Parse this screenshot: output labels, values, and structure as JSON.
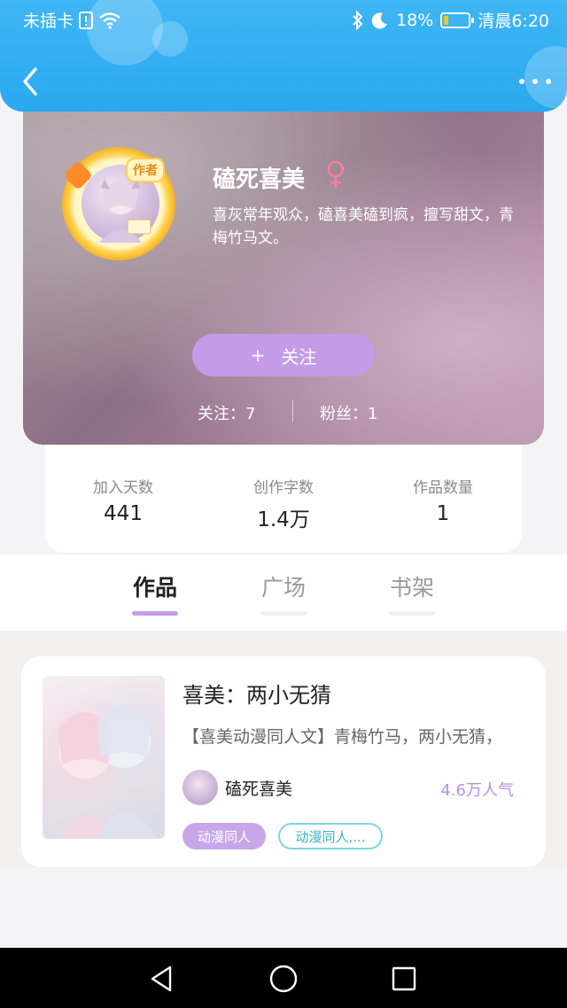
{
  "status_bar": {
    "carrier": "未插卡",
    "battery_percent": "18%",
    "battery_level": 0.18,
    "time": "清晨6:20",
    "icons": [
      "sim-alert-icon",
      "wifi-icon",
      "bluetooth-icon",
      "moon-icon",
      "battery-icon"
    ]
  },
  "header": {
    "back_icon": "chevron-left-icon",
    "more_icon": "more-dots-icon"
  },
  "profile": {
    "author_badge": "作者",
    "nickname": "磕死喜美",
    "gender_icon": "female-icon",
    "bio": "喜灰常年观众，磕喜美磕到疯，擅写甜文，青梅竹马文。",
    "follow_button": "关注",
    "follow_plus": "+",
    "following_label": "关注：7",
    "fans_label": "粉丝：1"
  },
  "stats": [
    {
      "label": "加入天数",
      "value": "441"
    },
    {
      "label": "创作字数",
      "value": "1.4万"
    },
    {
      "label": "作品数量",
      "value": "1"
    }
  ],
  "tabs": [
    {
      "label": "作品",
      "active": true
    },
    {
      "label": "广场",
      "active": false
    },
    {
      "label": "书架",
      "active": false
    }
  ],
  "works": [
    {
      "title": "喜美：两小无猜",
      "description": "【喜美动漫同人文】青梅竹马，两小无猜，",
      "author": "磕死喜美",
      "popularity": "4.6万人气",
      "tags": [
        "动漫同人",
        "动漫同人,..."
      ]
    }
  ],
  "colors": {
    "header_blue": "#2aa9f0",
    "accent_purple": "#c49be6",
    "tag_cyan": "#7fd4e6"
  }
}
